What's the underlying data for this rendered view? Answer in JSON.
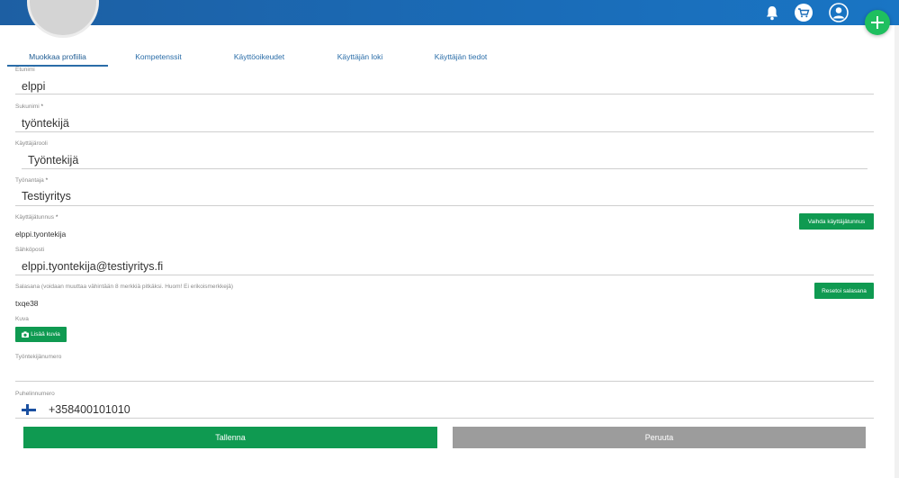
{
  "tabs": [
    {
      "label": "Muokkaa profiilia",
      "active": true
    },
    {
      "label": "Kompetenssit",
      "active": false
    },
    {
      "label": "Käyttöoikeudet",
      "active": false
    },
    {
      "label": "Käyttäjän loki",
      "active": false
    },
    {
      "label": "Käyttäjän tiedot",
      "active": false
    }
  ],
  "header": {
    "icons": [
      "bell-icon",
      "cart-icon",
      "user-icon",
      "plus-icon"
    ],
    "accent": "#1a6cb8",
    "fab_color": "#1fbf5f"
  },
  "form": {
    "firstname": {
      "label": "Etunimi",
      "value": "elppi"
    },
    "lastname": {
      "label": "Sukunimi",
      "required": "*",
      "value": "työntekijä"
    },
    "role": {
      "label": "Käyttäjärooli",
      "value": "Työntekijä"
    },
    "employer": {
      "label": "Työnantaja",
      "required": "*",
      "value": "Testiyritys"
    },
    "username": {
      "label": "Käyttäjätunnus",
      "required": "*",
      "value": "elppi.tyontekija",
      "button": "Vaihda käyttäjätunnus"
    },
    "email": {
      "label": "Sähköposti",
      "value": "elppi.tyontekija@testiyritys.fi"
    },
    "password": {
      "label": "Salasana (voidaan muuttaa vähintään 8 merkkiä pitkäksi. Huom! Ei erikoismerkkejä)",
      "value": "txqe38",
      "button": "Resetoi salasana"
    },
    "image": {
      "label": "Kuva",
      "button": "Lisää kuvia"
    },
    "employee_number": {
      "label": "Työntekijänumero",
      "value": ""
    },
    "phone": {
      "label": "Puhelinnumero",
      "value": "+358400101010"
    }
  },
  "actions": {
    "save": "Tallenna",
    "cancel": "Peruuta",
    "save_color": "#0f9a51",
    "cancel_color": "#9c9c9c"
  }
}
